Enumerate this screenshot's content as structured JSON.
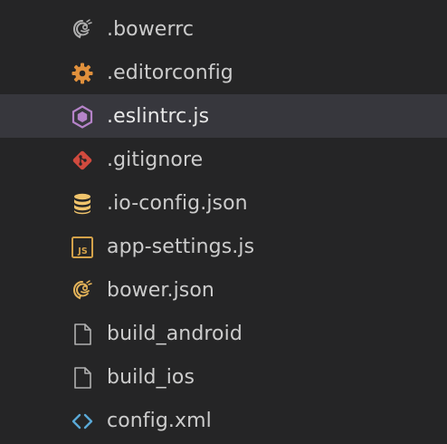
{
  "explorer": {
    "selected_index": 2,
    "files": [
      {
        "label": ".bowerrc",
        "icon": "bower-icon",
        "color": "#b0b0b0"
      },
      {
        "label": ".editorconfig",
        "icon": "gear-icon",
        "color": "#e0903c"
      },
      {
        "label": ".eslintrc.js",
        "icon": "eslint-icon",
        "color": "#b583c9"
      },
      {
        "label": ".gitignore",
        "icon": "git-icon",
        "color": "#d04a3e"
      },
      {
        "label": ".io-config.json",
        "icon": "database-icon",
        "color": "#f0c46c"
      },
      {
        "label": "app-settings.js",
        "icon": "javascript-icon",
        "color": "#d4a24a"
      },
      {
        "label": "bower.json",
        "icon": "bower-icon",
        "color": "#e6b55a"
      },
      {
        "label": "build_android",
        "icon": "file-icon",
        "color": "#b0b0b0"
      },
      {
        "label": "build_ios",
        "icon": "file-icon",
        "color": "#b0b0b0"
      },
      {
        "label": "config.xml",
        "icon": "code-icon",
        "color": "#5aa8d6"
      }
    ]
  }
}
